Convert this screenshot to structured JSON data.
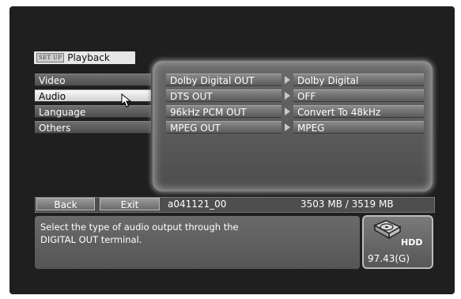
{
  "header": {
    "badge": "SET UP",
    "title": "Playback"
  },
  "categories": [
    {
      "label": "Video"
    },
    {
      "label": "Audio",
      "selected": true
    },
    {
      "label": "Language"
    },
    {
      "label": "Others"
    }
  ],
  "settings": [
    {
      "name": "Dolby Digital OUT",
      "value": "Dolby Digital"
    },
    {
      "name": "DTS OUT",
      "value": "OFF"
    },
    {
      "name": "96kHz PCM OUT",
      "value": "Convert To 48kHz"
    },
    {
      "name": "MPEG OUT",
      "value": "MPEG"
    }
  ],
  "bottom_bar": {
    "back_label": "Back",
    "exit_label": "Exit",
    "file_name": "a041121_00",
    "storage": "3503 MB / 3519 MB"
  },
  "help": {
    "text": "Select the type of audio output through the\nDIGITAL OUT terminal."
  },
  "hdd": {
    "label": "HDD",
    "free": "97.43(G)"
  },
  "icons": {
    "cursor": "arrow-cursor-icon",
    "hdd": "hard-disk-icon",
    "row_arrow": "chevron-right-icon"
  },
  "colors": {
    "selected_bg": "#e6e6e6",
    "item_bg": "#5e5e5e",
    "panel_bg": "#5a5a5a",
    "text": "#ffffff"
  }
}
